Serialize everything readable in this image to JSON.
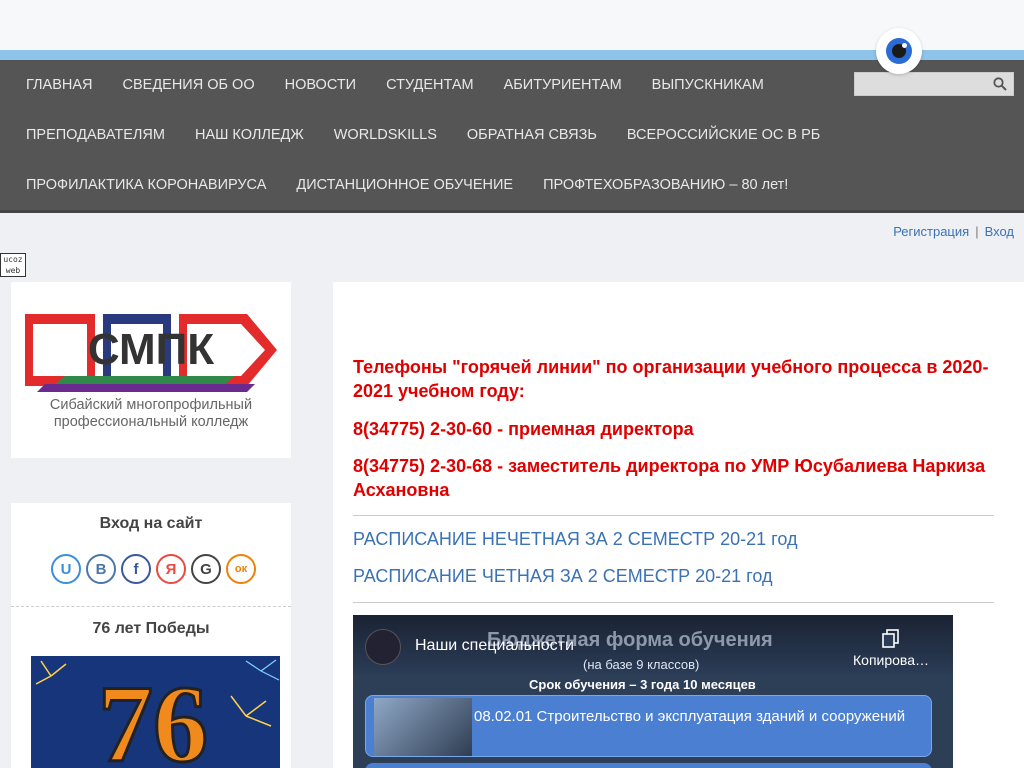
{
  "nav": {
    "row1": [
      "ГЛАВНАЯ",
      "СВЕДЕНИЯ ОБ ОО",
      "НОВОСТИ",
      "СТУДЕНТАМ",
      "АБИТУРИЕНТАМ",
      "ВЫПУСКНИКАМ"
    ],
    "row2": [
      "ПРЕПОДАВАТЕЛЯМ",
      "НАШ КОЛЛЕДЖ",
      "WORLDSKILLS",
      "ОБРАТНАЯ СВЯЗЬ",
      "ВСЕРОССИЙСКИЕ ОС В РБ"
    ],
    "row3": [
      "ПРОФИЛАКТИКА КОРОНАВИРУСА",
      "ДИСТАНЦИОННОЕ ОБУЧЕНИЕ",
      "ПРОФТЕХОБРАЗОВАНИЮ – 80 лет!"
    ]
  },
  "search": {
    "placeholder": ""
  },
  "auth": {
    "register": "Регистрация",
    "separator": "|",
    "login": "Вход"
  },
  "ucoz": {
    "line1": "ucoz",
    "line2": "web"
  },
  "logo": {
    "letters": "СМПК",
    "caption_line1": "Сибайский многопрофильный",
    "caption_line2": "профессиональный колледж"
  },
  "login_block": {
    "title": "Вход на сайт",
    "socials": [
      "U",
      "B",
      "f",
      "Я",
      "G",
      "ок"
    ]
  },
  "victory_block": {
    "title": "76 лет Победы",
    "number": "76"
  },
  "main": {
    "hotline_title": "Телефоны \"горячей линии\" по организации учебного процесса в 2020-2021 учебном году:",
    "phone1": "8(34775) 2-30-60 - приемная директора",
    "phone2": "8(34775) 2-30-68 - заместитель директора по УМР Юсубалиева Наркиза Асхановна",
    "link1": "РАСПИСАНИЕ НЕЧЕТНАЯ ЗА 2 СЕМЕСТР 20-21 год",
    "link2": "РАСПИСАНИЕ ЧЕТНАЯ ЗА 2 СЕМЕСТР 20-21 год"
  },
  "video": {
    "title": "Наши специальности",
    "copy_label": "Копирова…",
    "bg_heading": "Бюджетная форма обучения",
    "bg_sub": "(на базе 9 классов)",
    "bg_term": "Срок обучения – 3 года 10 месяцев",
    "card_text": "08.02.01 Строительство и эксплуатация зданий и сооружений"
  },
  "colors": {
    "accent": "#e00000",
    "link": "#3a72b5",
    "nav_bg": "#555555"
  }
}
